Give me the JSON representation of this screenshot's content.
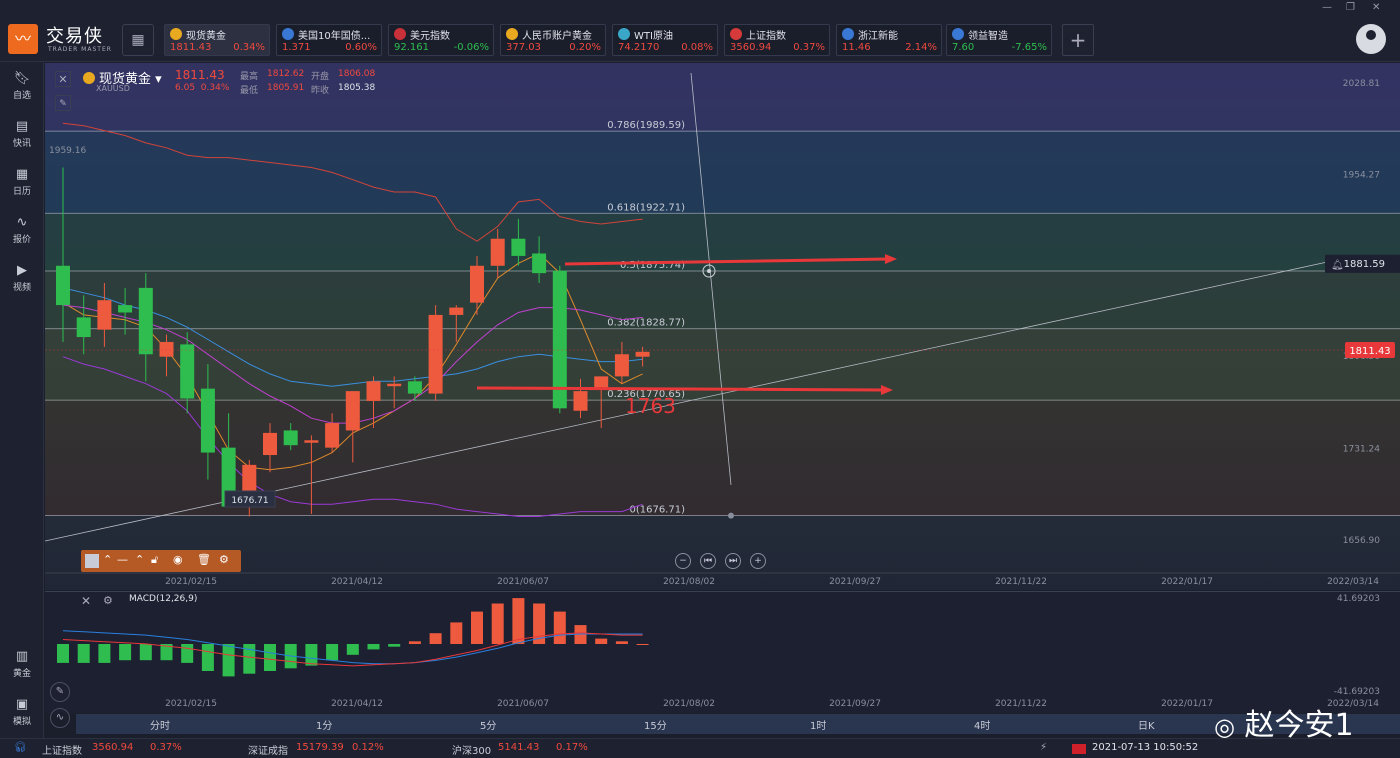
{
  "app": {
    "brand": "交易侠",
    "brand_sub": "TRADER MASTER"
  },
  "tickers": [
    {
      "name": "现货黄金",
      "price": "1811.43",
      "change": "0.34%",
      "dir": "up",
      "icon_color": "#e8a920",
      "icon": "gold-coin-icon",
      "active": true
    },
    {
      "name": "美国10年国债...",
      "price": "1.371",
      "change": "0.60%",
      "dir": "up",
      "icon_color": "#3a78d6",
      "icon": "bar-chart-icon"
    },
    {
      "name": "美元指数",
      "price": "92.161",
      "change": "-0.06%",
      "dir": "down",
      "icon_color": "#c8303a",
      "icon": "us-flag-icon"
    },
    {
      "name": "人民币账户黄金",
      "price": "377.03",
      "change": "0.20%",
      "dir": "up",
      "icon_color": "#e8a920",
      "icon": "gold-coin-icon"
    },
    {
      "name": "WTI原油",
      "price": "74.2170",
      "change": "0.08%",
      "dir": "up",
      "icon_color": "#3aa7c8",
      "icon": "oil-drum-icon"
    },
    {
      "name": "上证指数",
      "price": "3560.94",
      "change": "0.37%",
      "dir": "up",
      "icon_color": "#d63a3a",
      "icon": "sse-logo-icon"
    },
    {
      "name": "浙江新能",
      "price": "11.46",
      "change": "2.14%",
      "dir": "up",
      "icon_color": "#3a78d6",
      "icon": "bar-chart-icon"
    },
    {
      "name": "领益智造",
      "price": "7.60",
      "change": "-7.65%",
      "dir": "down",
      "icon_color": "#3a78d6",
      "icon": "bar-chart-icon"
    }
  ],
  "sidebar": [
    {
      "label": "自选",
      "icon": "bookmark-icon"
    },
    {
      "label": "快讯",
      "icon": "news-icon"
    },
    {
      "label": "日历",
      "icon": "calendar-icon"
    },
    {
      "label": "报价",
      "icon": "quote-icon"
    },
    {
      "label": "视频",
      "icon": "video-icon"
    },
    {
      "label": "黄金",
      "icon": "gold-icon"
    },
    {
      "label": "模拟",
      "icon": "wallet-icon"
    }
  ],
  "quote": {
    "name": "现货黄金",
    "code": "XAUUSD",
    "price": "1811.43",
    "change": "6.05",
    "change_pct": "0.34%",
    "high_label": "最高",
    "high": "1812.62",
    "open_label": "开盘",
    "open": "1806.08",
    "low_label": "最低",
    "low": "1805.91",
    "prev_label": "昨收",
    "prev": "1805.38"
  },
  "chart_data": {
    "type": "candlestick",
    "y_axis_ticks": [
      "2028.81",
      "1954.27",
      "1881.59",
      "1806.56",
      "1731.24",
      "1656.90"
    ],
    "ylim": [
      1630,
      2045
    ],
    "x_axis_ticks": [
      "2021/02/15",
      "2021/04/12",
      "2021/06/07",
      "2021/08/02",
      "2021/09/27",
      "2021/11/22",
      "2022/01/17",
      "2022/03/14"
    ],
    "fib_levels": [
      {
        "label": "0.786(1989.59)",
        "value": 1989.59
      },
      {
        "label": "0.618(1922.71)",
        "value": 1922.71
      },
      {
        "label": "0.5(1875.74)",
        "value": 1875.74
      },
      {
        "label": "0.382(1828.77)",
        "value": 1828.77
      },
      {
        "label": "0.236(1770.65)",
        "value": 1770.65
      },
      {
        "label": "0(1676.71)",
        "value": 1676.71
      }
    ],
    "left_value_label": "1959.16",
    "low_marker_label": "1676.71",
    "alert_price_label": "1881.59",
    "current_price_label": "1811.43",
    "annotation_text": "1763",
    "candles": [
      {
        "o": 1880,
        "h": 1960,
        "l": 1818,
        "c": 1848
      },
      {
        "o": 1838,
        "h": 1856,
        "l": 1808,
        "c": 1822
      },
      {
        "o": 1828,
        "h": 1866,
        "l": 1814,
        "c": 1852
      },
      {
        "o": 1848,
        "h": 1862,
        "l": 1824,
        "c": 1842
      },
      {
        "o": 1862,
        "h": 1874,
        "l": 1786,
        "c": 1808
      },
      {
        "o": 1806,
        "h": 1824,
        "l": 1790,
        "c": 1818
      },
      {
        "o": 1816,
        "h": 1826,
        "l": 1760,
        "c": 1772
      },
      {
        "o": 1780,
        "h": 1800,
        "l": 1706,
        "c": 1728
      },
      {
        "o": 1732,
        "h": 1760,
        "l": 1698,
        "c": 1684
      },
      {
        "o": 1686,
        "h": 1722,
        "l": 1676,
        "c": 1718
      },
      {
        "o": 1726,
        "h": 1752,
        "l": 1712,
        "c": 1744
      },
      {
        "o": 1746,
        "h": 1752,
        "l": 1730,
        "c": 1734
      },
      {
        "o": 1736,
        "h": 1742,
        "l": 1678,
        "c": 1738
      },
      {
        "o": 1732,
        "h": 1760,
        "l": 1728,
        "c": 1752
      },
      {
        "o": 1746,
        "h": 1762,
        "l": 1720,
        "c": 1778
      },
      {
        "o": 1770,
        "h": 1790,
        "l": 1748,
        "c": 1786
      },
      {
        "o": 1782,
        "h": 1790,
        "l": 1764,
        "c": 1784
      },
      {
        "o": 1786,
        "h": 1790,
        "l": 1770,
        "c": 1776
      },
      {
        "o": 1776,
        "h": 1848,
        "l": 1770,
        "c": 1840
      },
      {
        "o": 1840,
        "h": 1848,
        "l": 1818,
        "c": 1846
      },
      {
        "o": 1850,
        "h": 1888,
        "l": 1840,
        "c": 1880
      },
      {
        "o": 1880,
        "h": 1910,
        "l": 1870,
        "c": 1902
      },
      {
        "o": 1902,
        "h": 1918,
        "l": 1880,
        "c": 1888
      },
      {
        "o": 1890,
        "h": 1904,
        "l": 1866,
        "c": 1874
      },
      {
        "o": 1876,
        "h": 1880,
        "l": 1760,
        "c": 1764
      },
      {
        "o": 1762,
        "h": 1788,
        "l": 1756,
        "c": 1778
      },
      {
        "o": 1780,
        "h": 1790,
        "l": 1748,
        "c": 1790
      },
      {
        "o": 1790,
        "h": 1818,
        "l": 1784,
        "c": 1808
      },
      {
        "o": 1806,
        "h": 1814,
        "l": 1798,
        "c": 1810
      }
    ]
  },
  "macd": {
    "label": "MACD(12,26,9)",
    "y_top": "41.69203",
    "y_bottom": "-41.69203",
    "x_axis_ticks": [
      "2021/02/15",
      "2021/04/12",
      "2021/06/07",
      "2021/08/02",
      "2021/09/27",
      "2021/11/22",
      "2022/01/17",
      "2022/03/14"
    ],
    "hist": [
      -14,
      -14,
      -14,
      -12,
      -12,
      -12,
      -14,
      -20,
      -24,
      -22,
      -20,
      -18,
      -16,
      -12,
      -8,
      -4,
      -2,
      2,
      8,
      16,
      24,
      30,
      34,
      30,
      24,
      14,
      4,
      2,
      0
    ]
  },
  "timeframes": [
    "分时",
    "1分",
    "5分",
    "15分",
    "1时",
    "4时",
    "日K"
  ],
  "statusbar": {
    "sh_label": "上证指数",
    "sh_value": "3560.94",
    "sh_chg": "0.37%",
    "sz_label": "深证成指",
    "sz_value": "15179.39",
    "sz_chg": "0.12%",
    "hs_label": "沪深300",
    "hs_value": "5141.43",
    "hs_chg": "0.17%",
    "datetime": "2021-07-13 10:50:52"
  },
  "watermark": "赵今安1"
}
